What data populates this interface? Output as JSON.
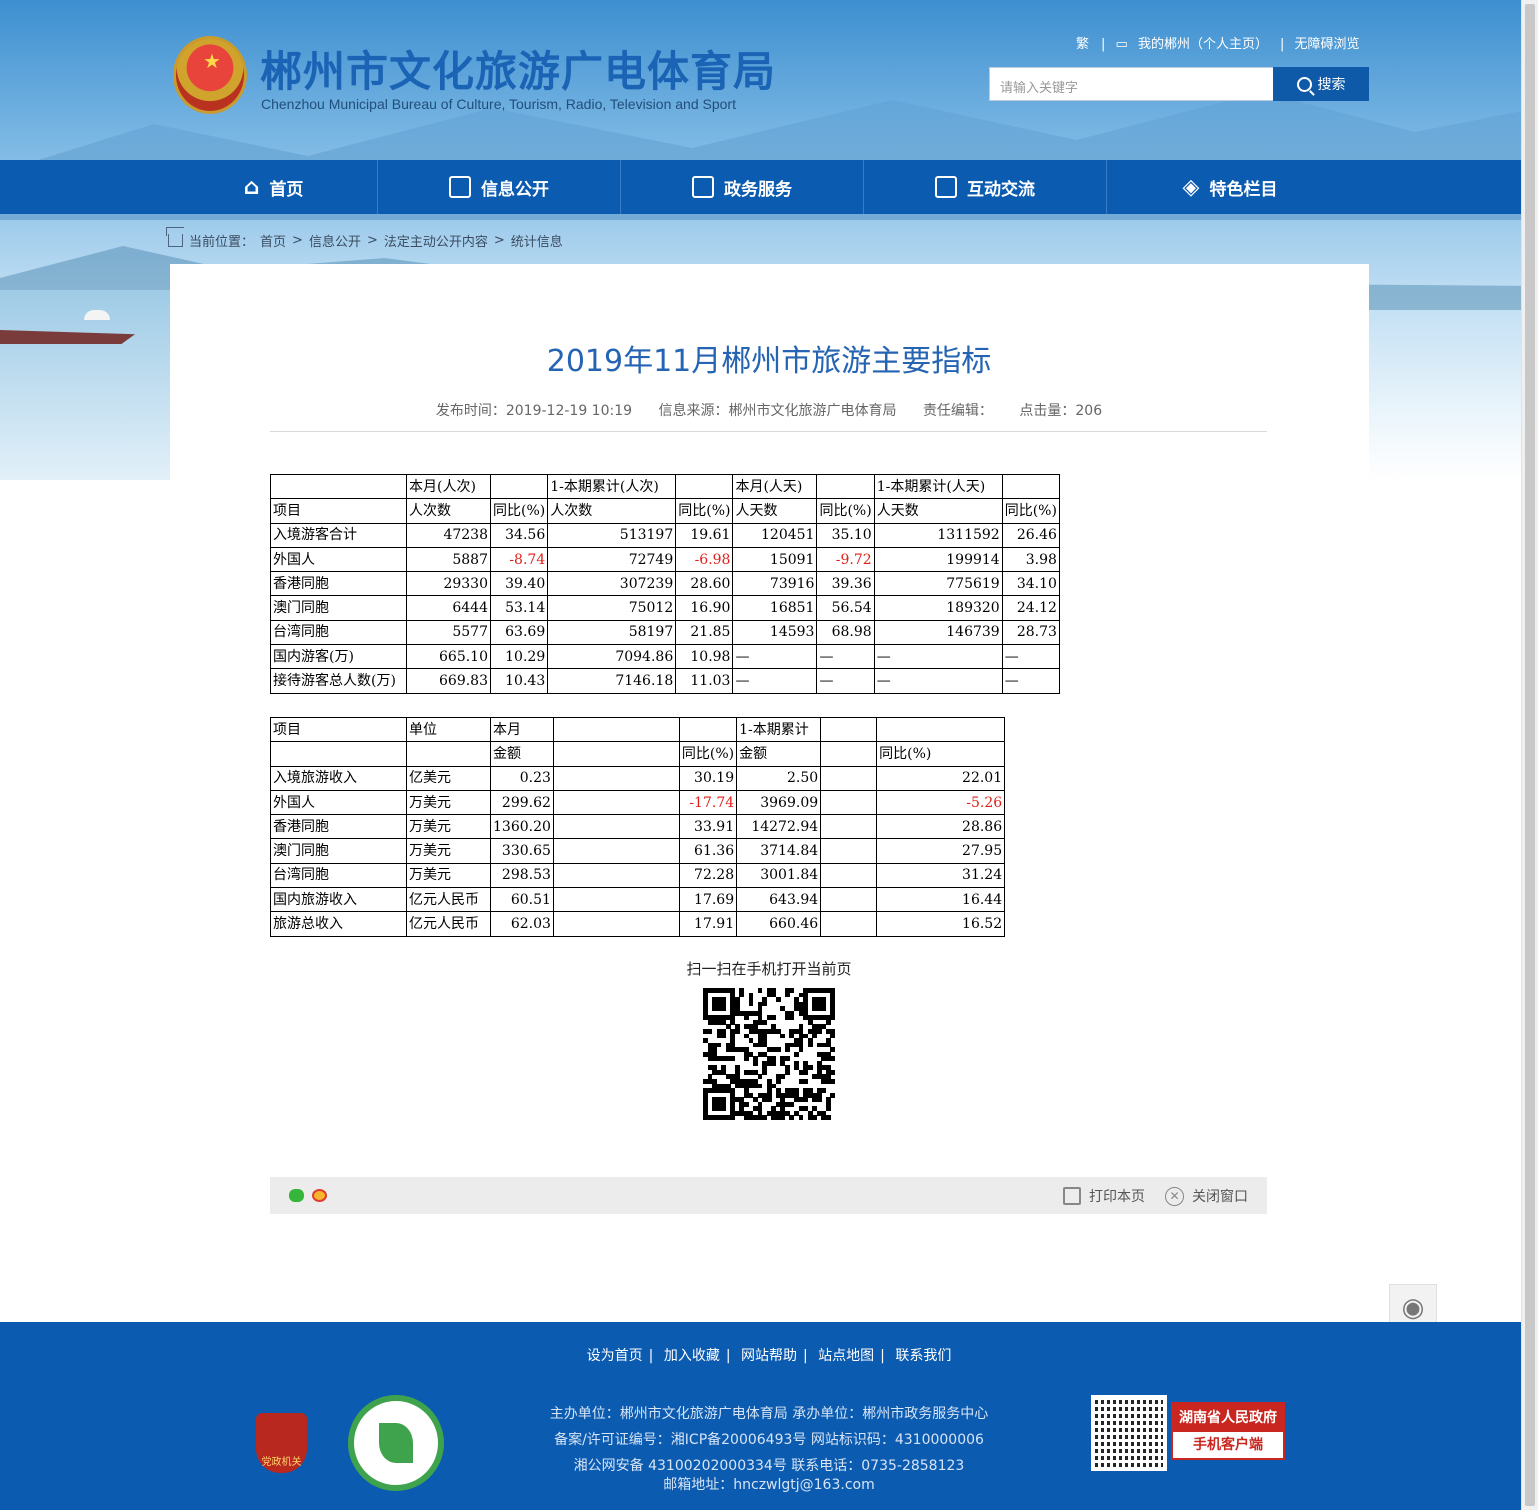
{
  "header": {
    "title": "郴州市文化旅游广电体育局",
    "subtitle": "Chenzhou Municipal Bureau of Culture, Tourism, Radio, Television and Sport",
    "toplinks": [
      "繁",
      "我的郴州（个人主页）",
      "无障碍浏览"
    ],
    "search_placeholder": "请输入关键字",
    "search_button": "搜索"
  },
  "nav": [
    {
      "label": "首页",
      "icon": "home-icon"
    },
    {
      "label": "信息公开",
      "icon": "document-icon"
    },
    {
      "label": "政务服务",
      "icon": "edit-icon"
    },
    {
      "label": "互动交流",
      "icon": "chat-icon"
    },
    {
      "label": "特色栏目",
      "icon": "layers-icon"
    }
  ],
  "breadcrumb": {
    "prefix": "当前位置：",
    "items": [
      "首页",
      "信息公开",
      "法定主动公开内容",
      "统计信息"
    ],
    "separator": ">"
  },
  "article": {
    "title": "2019年11月郴州市旅游主要指标",
    "meta": {
      "published": "发布时间：2019-12-19 10:19",
      "source": "信息来源：郴州市文化旅游广电体育局",
      "editor": "责任编辑：",
      "views": "点击量：206"
    }
  },
  "table1": {
    "head1": [
      "",
      "本月(人次)",
      "",
      "1-本期累计(人次)",
      "",
      "本月(人天)",
      "",
      "1-本期累计(人天)",
      ""
    ],
    "head2": [
      "项目",
      "人次数",
      "同比(%)",
      "人次数",
      "同比(%)",
      "人天数",
      "同比(%)",
      "人天数",
      "同比(%)"
    ],
    "rows": [
      [
        "入境游客合计",
        "47238",
        "34.56",
        "513197",
        "19.61",
        "120451",
        "35.10",
        "1311592",
        "26.46"
      ],
      [
        "外国人",
        "5887",
        "-8.74",
        "72749",
        "-6.98",
        "15091",
        "-9.72",
        "199914",
        "3.98"
      ],
      [
        "香港同胞",
        "29330",
        "39.40",
        "307239",
        "28.60",
        "73916",
        "39.36",
        "775619",
        "34.10"
      ],
      [
        "澳门同胞",
        "6444",
        "53.14",
        "75012",
        "16.90",
        "16851",
        "56.54",
        "189320",
        "24.12"
      ],
      [
        "台湾同胞",
        "5577",
        "63.69",
        "58197",
        "21.85",
        "14593",
        "68.98",
        "146739",
        "28.73"
      ],
      [
        "国内游客(万)",
        "665.10",
        "10.29",
        "7094.86",
        "10.98",
        "—",
        "—",
        "—",
        "—"
      ],
      [
        "接待游客总人数(万)",
        "669.83",
        "10.43",
        "7146.18",
        "11.03",
        "—",
        "—",
        "—",
        "—"
      ]
    ]
  },
  "table2": {
    "head1": [
      "项目",
      "单位",
      "本月",
      "",
      "",
      "1-本期累计",
      "",
      ""
    ],
    "head2": [
      "",
      "",
      "金额",
      "",
      "同比(%)",
      "金额",
      "",
      "同比(%)"
    ],
    "rows": [
      [
        "入境旅游收入",
        "亿美元",
        "0.23",
        "",
        "30.19",
        "2.50",
        "",
        "22.01"
      ],
      [
        "外国人",
        "万美元",
        "299.62",
        "",
        "-17.74",
        "3969.09",
        "",
        "-5.26"
      ],
      [
        "香港同胞",
        "万美元",
        "1360.20",
        "",
        "33.91",
        "14272.94",
        "",
        "28.86"
      ],
      [
        "澳门同胞",
        "万美元",
        "330.65",
        "",
        "61.36",
        "3714.84",
        "",
        "27.95"
      ],
      [
        "台湾同胞",
        "万美元",
        "298.53",
        "",
        "72.28",
        "3001.84",
        "",
        "31.24"
      ],
      [
        "国内旅游收入",
        "亿元人民币",
        "60.51",
        "",
        "17.69",
        "643.94",
        "",
        "16.44"
      ],
      [
        "旅游总收入",
        "亿元人民币",
        "62.03",
        "",
        "17.91",
        "660.46",
        "",
        "16.52"
      ]
    ]
  },
  "qr_label": "扫一扫在手机打开当前页",
  "sharebar": {
    "print": "打印本页",
    "close": "关闭窗口"
  },
  "footer": {
    "links": [
      "设为首页",
      "加入收藏",
      "网站帮助",
      "站点地图",
      "联系我们"
    ],
    "line1": "主办单位：郴州市文化旅游广电体育局   承办单位：郴州市政务服务中心",
    "line2": "备案/许可证编号：湘ICP备20006493号    网站标识码：4310000006",
    "line3": "湘公网安备 43100202000334号   联系电话：0735-2858123",
    "line4": "邮箱地址：hnczwlgtj@163.com",
    "badge_text": "党政机关",
    "app_line1": "湖南省人民政府",
    "app_line2": "手机客户端"
  },
  "colors": {
    "primary": "#0b5bb1",
    "title": "#2563b3",
    "negative": "#e0211a"
  }
}
